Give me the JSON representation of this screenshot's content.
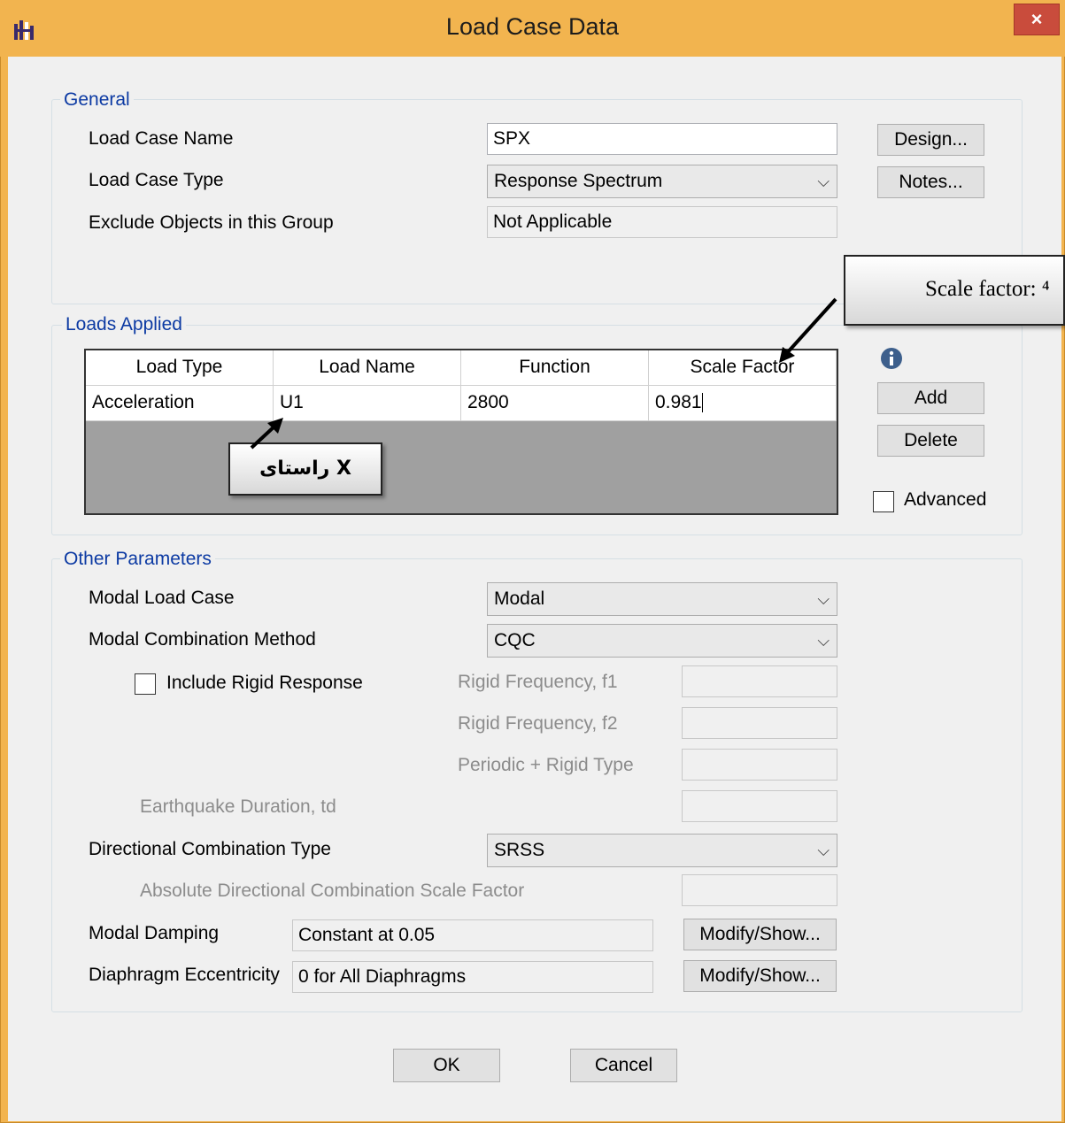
{
  "window": {
    "title": "Load Case Data",
    "close_label": "×"
  },
  "general": {
    "title": "General",
    "load_case_name_label": "Load Case Name",
    "load_case_name_value": "SPX",
    "load_case_type_label": "Load Case Type",
    "load_case_type_value": "Response Spectrum",
    "exclude_label": "Exclude Objects in this Group",
    "exclude_value": "Not Applicable",
    "design_button": "Design...",
    "notes_button": "Notes..."
  },
  "loads_applied": {
    "title": "Loads Applied",
    "columns": [
      "Load Type",
      "Load Name",
      "Function",
      "Scale Factor"
    ],
    "rows": [
      [
        "Acceleration",
        "U1",
        "2800",
        "0.981"
      ]
    ],
    "add_button": "Add",
    "delete_button": "Delete",
    "advanced_label": "Advanced"
  },
  "other": {
    "title": "Other Parameters",
    "modal_load_case_label": "Modal Load Case",
    "modal_load_case_value": "Modal",
    "modal_combination_label": "Modal Combination Method",
    "modal_combination_value": "CQC",
    "include_rigid_label": "Include Rigid Response",
    "rigid_f1_label": "Rigid Frequency, f1",
    "rigid_f2_label": "Rigid Frequency, f2",
    "periodic_label": "Periodic + Rigid Type",
    "eq_duration_label": "Earthquake Duration, td",
    "directional_label": "Directional Combination Type",
    "directional_value": "SRSS",
    "abs_dir_label": "Absolute Directional Combination Scale Factor",
    "modal_damping_label": "Modal Damping",
    "modal_damping_value": "Constant at 0.05",
    "diaphragm_label": "Diaphragm Eccentricity",
    "diaphragm_value": "0 for All Diaphragms",
    "modify_show_label": "Modify/Show..."
  },
  "footer": {
    "ok_label": "OK",
    "cancel_label": "Cancel"
  },
  "annotations": {
    "scale_factor_note": "Scale factor: ⁴",
    "direction_note": "راستای X"
  },
  "colors": {
    "title_bar": "#f2b44f",
    "group_title": "#0c3aa3",
    "close": "#c94c3c",
    "grid_empty": "#a0a0a0"
  }
}
